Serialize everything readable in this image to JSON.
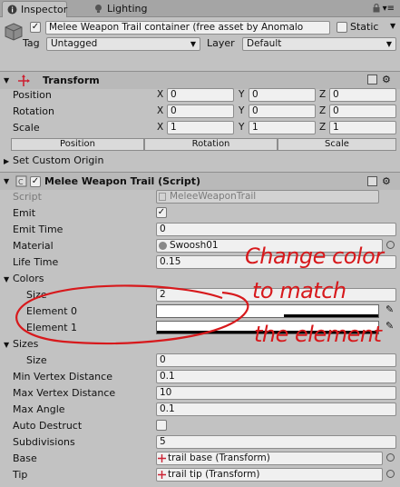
{
  "tabs": {
    "inspector": "Inspector",
    "lighting": "Lighting"
  },
  "gameobject": {
    "name": "Melee Weapon Trail container (free asset by Anomalo",
    "static_label": "Static",
    "tag_label": "Tag",
    "tag_value": "Untagged",
    "layer_label": "Layer",
    "layer_value": "Default"
  },
  "transform": {
    "title": "Transform",
    "rows": [
      {
        "label": "Position",
        "x": "0",
        "y": "0",
        "z": "0"
      },
      {
        "label": "Rotation",
        "x": "0",
        "y": "0",
        "z": "0"
      },
      {
        "label": "Scale",
        "x": "1",
        "y": "1",
        "z": "1"
      }
    ],
    "axis": {
      "x": "X",
      "y": "Y",
      "z": "Z"
    },
    "buttons": [
      "Position",
      "Rotation",
      "Scale"
    ],
    "custom_origin": "Set Custom Origin"
  },
  "trail": {
    "title": "Melee Weapon Trail (Script)",
    "script_label": "Script",
    "script_value": "MeleeWeaponTrail",
    "emit_label": "Emit",
    "emit_time_label": "Emit Time",
    "emit_time_value": "0",
    "material_label": "Material",
    "material_value": "Swoosh01",
    "life_time_label": "Life Time",
    "life_time_value": "0.15",
    "colors_label": "Colors",
    "colors_size_label": "Size",
    "colors_size_value": "2",
    "element0_label": "Element 0",
    "element1_label": "Element 1",
    "sizes_label": "Sizes",
    "sizes_size_label": "Size",
    "sizes_size_value": "0",
    "min_vertex_label": "Min Vertex Distance",
    "min_vertex_value": "0.1",
    "max_vertex_label": "Max Vertex Distance",
    "max_vertex_value": "10",
    "max_angle_label": "Max Angle",
    "max_angle_value": "0.1",
    "auto_destruct_label": "Auto Destruct",
    "subdivisions_label": "Subdivisions",
    "subdivisions_value": "5",
    "base_label": "Base",
    "base_value": "trail base (Transform)",
    "tip_label": "Tip",
    "tip_value": "trail tip (Transform)"
  },
  "annotation": {
    "line1": "Change color",
    "line2": "to match",
    "line3": "the element"
  },
  "colors": {
    "annotation_red": "#d7191c",
    "panel_bg": "#c2c2c2"
  }
}
